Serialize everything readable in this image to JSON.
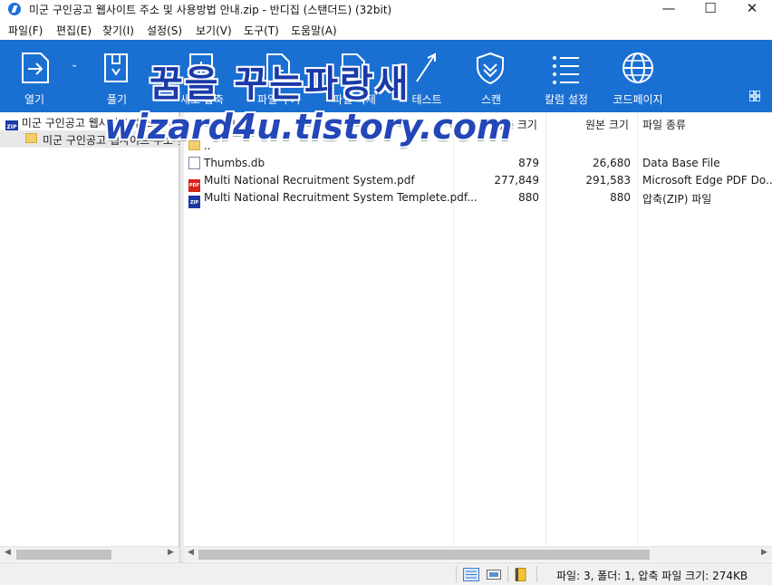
{
  "window": {
    "title": "미군 구인공고 웹사이트 주소 및 사용방법 안내.zip - 반디집 (스탠더드) (32bit)",
    "minimize": "—",
    "maximize": "☐",
    "close": "✕"
  },
  "menu": [
    "파일(F)",
    "편집(E)",
    "찾기(I)",
    "설정(S)",
    "보기(V)",
    "도구(T)",
    "도움말(A)"
  ],
  "toolbar": {
    "items": [
      {
        "label": "열기",
        "icon": "open-icon"
      },
      {
        "label": "풀기",
        "icon": "extract-icon"
      },
      {
        "label": "새로 압축",
        "icon": "new-archive-icon"
      },
      {
        "label": "파일 추가",
        "icon": "add-file-icon"
      },
      {
        "label": "파일 삭제",
        "icon": "delete-file-icon"
      },
      {
        "label": "테스트",
        "icon": "test-icon"
      },
      {
        "label": "스캔",
        "icon": "scan-shield-icon"
      },
      {
        "label": "칼럼 설정",
        "icon": "column-settings-icon"
      },
      {
        "label": "코드페이지",
        "icon": "codepage-globe-icon"
      }
    ],
    "accent": "#1a6fd2"
  },
  "watermark": {
    "line1": "꿈을 꾸는파랑새",
    "line2": "wizard4u.tistory.com"
  },
  "tree": {
    "root": "미군 구인공고 웹사이트 주소 및 사용",
    "child": "미군 구인공고 웹사이트 주소 및 사"
  },
  "list": {
    "headers": {
      "name": "이름",
      "packed": "압축 크기",
      "original": "원본 크기",
      "type": "파일 종류"
    },
    "parent": "..",
    "rows": [
      {
        "name": "Thumbs.db",
        "packed": "879",
        "original": "26,680",
        "type": "Data Base File",
        "icon": "db-file-icon"
      },
      {
        "name": "Multi National Recruitment System.pdf",
        "packed": "277,849",
        "original": "291,583",
        "type": "Microsoft Edge PDF Do...",
        "icon": "pdf-file-icon"
      },
      {
        "name": "Multi National Recruitment System Templete.pdf...",
        "packed": "880",
        "original": "880",
        "type": "압축(ZIP) 파일",
        "icon": "zip-file-icon"
      }
    ]
  },
  "status": {
    "summary": "파일: 3, 폴더: 1, 압축 파일 크기: 274KB"
  }
}
